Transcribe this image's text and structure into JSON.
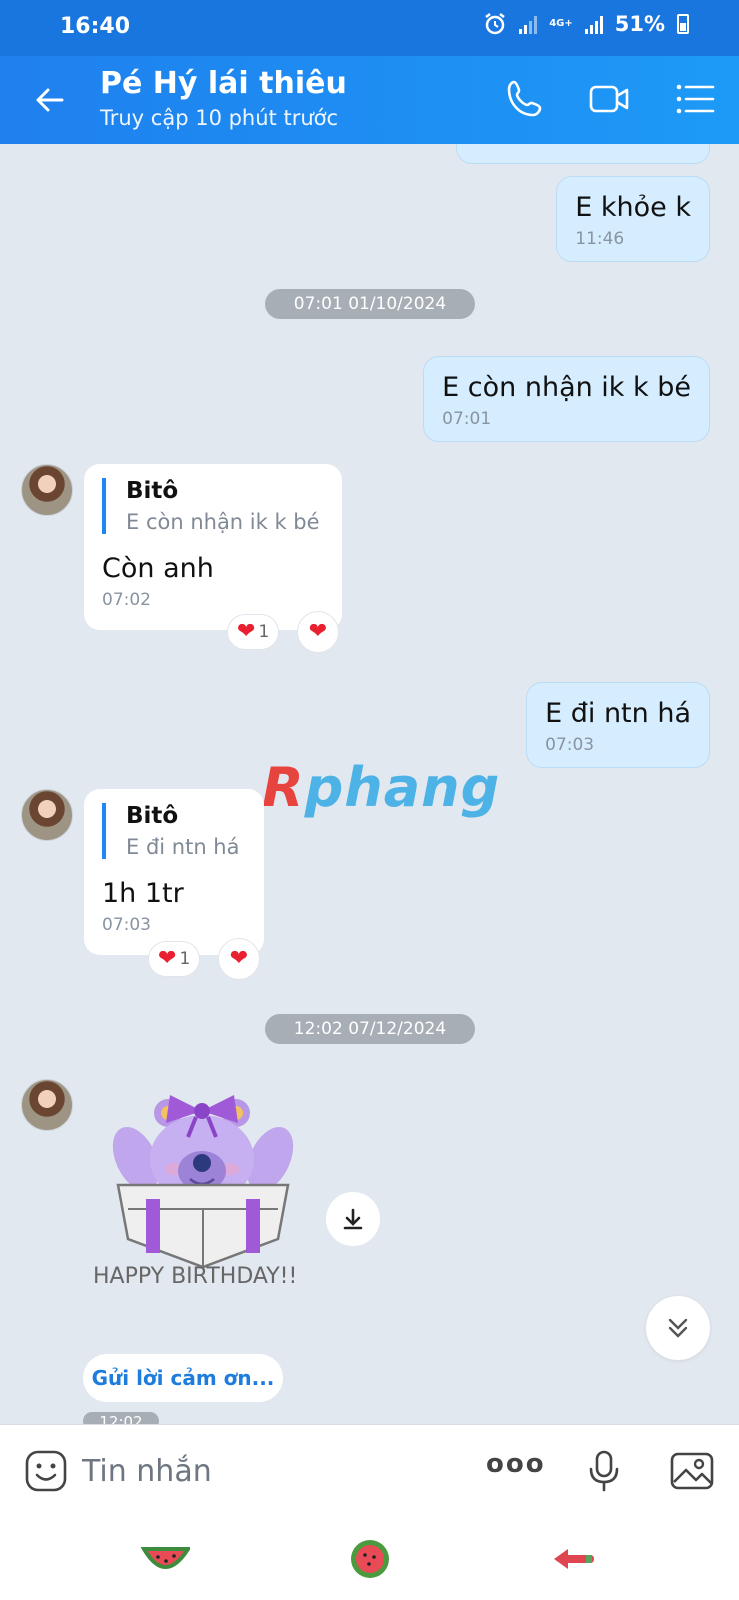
{
  "status_bar": {
    "time": "16:40",
    "network": "4G+",
    "battery": "51%"
  },
  "header": {
    "title": "Pé Hý lái thiêu",
    "subtitle": "Truy cập 10 phút trước"
  },
  "messages": {
    "m1": {
      "text": "E khỏe k",
      "time": "11:46"
    },
    "date1": "07:01 01/10/2024",
    "m2": {
      "text": "E còn nhận ik k bé",
      "time": "07:01"
    },
    "m3": {
      "quote_name": "Bitô",
      "quote_text": "E còn nhận ik k bé",
      "text": "Còn anh",
      "time": "07:02",
      "reaction_count": "1"
    },
    "m4": {
      "text": "E đi ntn há",
      "time": "07:03"
    },
    "m5": {
      "quote_name": "Bitô",
      "quote_text": "E đi ntn há",
      "text": "1h 1tr",
      "time": "07:03",
      "reaction_count": "1"
    },
    "date2": "12:02 07/12/2024",
    "sticker": {
      "caption": "HAPPY BIRTHDAY!!"
    },
    "thanks_button": "Gửi lời cảm ơn...",
    "last_time": "12:02"
  },
  "watermark": {
    "first": "R",
    "rest": "phang"
  },
  "composer": {
    "placeholder": "Tin nhắn",
    "more_label": "ooo"
  },
  "colors": {
    "header": "#1f80ee",
    "outgoing_bubble": "#d5edfe",
    "incoming_bubble": "#ffffff",
    "background": "#e2e8ef",
    "heart": "#e8202f"
  }
}
